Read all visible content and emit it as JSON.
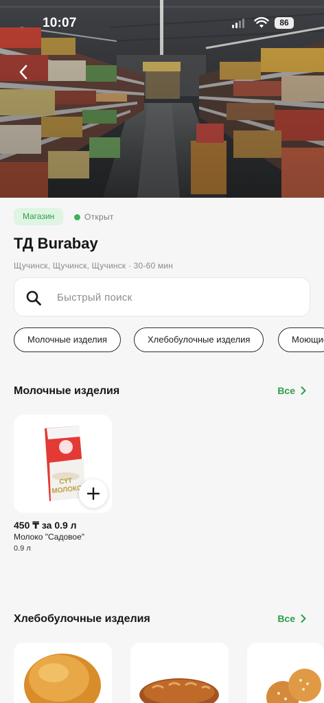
{
  "status_bar": {
    "time": "10:07",
    "battery": "86"
  },
  "store": {
    "type_badge": "Магазин",
    "status": "Открыт",
    "name": "ТД Burabay",
    "subtitle": "Щучинск, Щучинск, Щучинск · 30-60 мин",
    "status_color": "#3cb35a",
    "accent_color": "#2c9e4a"
  },
  "search": {
    "placeholder": "Быстрый поиск"
  },
  "categories": [
    "Молочные изделия",
    "Хлебобулочные изделия",
    "Моющие средства"
  ],
  "sections": [
    {
      "title": "Молочные изделия",
      "all_label": "Все",
      "products": [
        {
          "price": "450 ₸ за 0.9 л",
          "name": "Молоко \"Садовое\"",
          "qty": "0.9 л",
          "package_text": "СҮТ МОЛОКО"
        }
      ]
    },
    {
      "title": "Хлебобулочные изделия",
      "all_label": "Все"
    }
  ],
  "icons": {
    "back": "chevron-left-icon",
    "search": "search-icon",
    "add": "plus-icon",
    "see_all": "chevron-right-icon"
  }
}
